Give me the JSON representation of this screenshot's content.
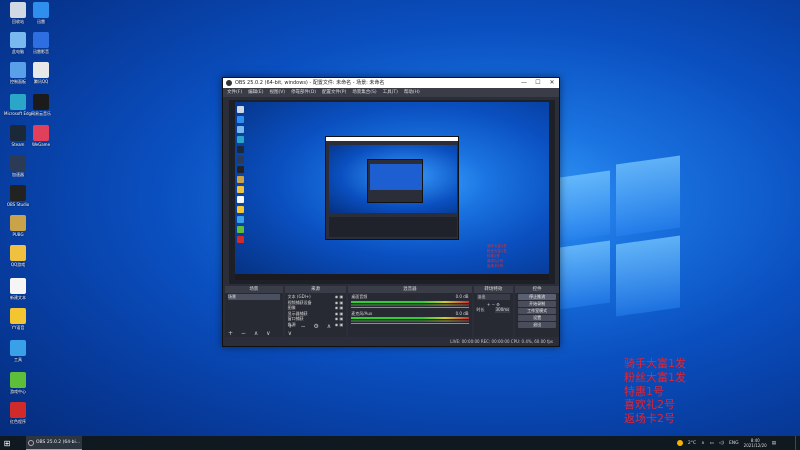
{
  "desktop": {
    "icons": [
      {
        "label": "回收站",
        "color": "#cfd8e3",
        "icon": "recycle-bin-icon"
      },
      {
        "label": "迅雷",
        "color": "#2f8fef",
        "icon": "xunlei-icon"
      },
      {
        "label": "此电脑",
        "color": "#7ab8f0",
        "icon": "this-pc-icon"
      },
      {
        "label": "迅雷影音",
        "color": "#2d6fe0",
        "icon": "xunlei-player-icon"
      },
      {
        "label": "控制面板",
        "color": "#5aa0e8",
        "icon": "control-panel-icon"
      },
      {
        "label": "腾讯QQ",
        "color": "#e8e8e8",
        "icon": "qq-icon"
      },
      {
        "label": "Microsoft Edge",
        "color": "#2aa6c9",
        "icon": "edge-icon"
      },
      {
        "label": "网易云音乐",
        "color": "#1b1b1b",
        "icon": "game-icon"
      },
      {
        "label": "Steam",
        "color": "#1b2838",
        "icon": "steam-icon"
      },
      {
        "label": "WeGame",
        "color": "#e0405a",
        "icon": "wegame-icon"
      },
      {
        "label": "加速器",
        "color": "#2b3a55",
        "icon": "accelerator-icon"
      },
      {
        "label": "OBS Studio",
        "color": "#222",
        "icon": "obs-icon"
      },
      {
        "label": "PUBG",
        "color": "#c9a24a",
        "icon": "pubg-icon"
      },
      {
        "label": "QQ游戏",
        "color": "#f0c040",
        "icon": "qq-game-icon"
      },
      {
        "label": "新建文本",
        "color": "#f5f5f5",
        "icon": "text-file-icon"
      },
      {
        "label": "YY语音",
        "color": "#f3c531",
        "icon": "yy-icon"
      },
      {
        "label": "工具",
        "color": "#3aa0e8",
        "icon": "tool-icon"
      },
      {
        "label": "游戏中心",
        "color": "#5dbe3a",
        "icon": "game-center-icon"
      },
      {
        "label": "红色程序",
        "color": "#d02a2a",
        "icon": "red-app-icon"
      }
    ]
  },
  "obs": {
    "title": "OBS 25.0.2 (64-bit, windows) - 配置文件: 未命名 - 场景: 未命名",
    "menu": [
      "文件(F)",
      "编辑(E)",
      "视图(V)",
      "停靠部件(D)",
      "配置文件(P)",
      "场景集合(S)",
      "工具(T)",
      "帮助(H)"
    ],
    "docks": {
      "scenes": {
        "header": "场景",
        "items": [
          "场景"
        ]
      },
      "sources": {
        "header": "来源",
        "items": [
          "文本 (GDI+)",
          "视频捕获设备",
          "图像",
          "显示器捕获",
          "窗口捕获",
          "色源"
        ]
      },
      "mixer": {
        "header": "混音器",
        "tracks": [
          {
            "name": "桌面音频",
            "level": "0.0 dB"
          },
          {
            "name": "麦克风/Aux",
            "level": "0.0 dB"
          }
        ]
      },
      "transitions": {
        "header": "转场特效",
        "type": "淡出",
        "duration_label": "时长",
        "duration": "300ms"
      },
      "controls": {
        "header": "控件",
        "buttons": [
          "停止推流",
          "开始录制",
          "工作室模式",
          "设置",
          "退出"
        ]
      }
    },
    "status": "LIVE: 00:00:00   REC: 00:00:00   CPU: 0.4%, 60.00 fps",
    "preview_overlay": [
      "骑手大富1发",
      "粉丝大富1发",
      "特惠1号",
      "喜欢礼2号",
      "返场卡2号"
    ]
  },
  "overlay_text": [
    "骑手大富1发",
    "粉丝大富1发",
    "特惠1号",
    "喜欢礼2号",
    "返场卡2号"
  ],
  "taskbar": {
    "start_icon": "windows-icon",
    "app_label": "OBS 25.0.2 (64-bi...",
    "weather": "2°C",
    "lang": "ENG",
    "time": "8:40",
    "date": "2021/12/20"
  }
}
